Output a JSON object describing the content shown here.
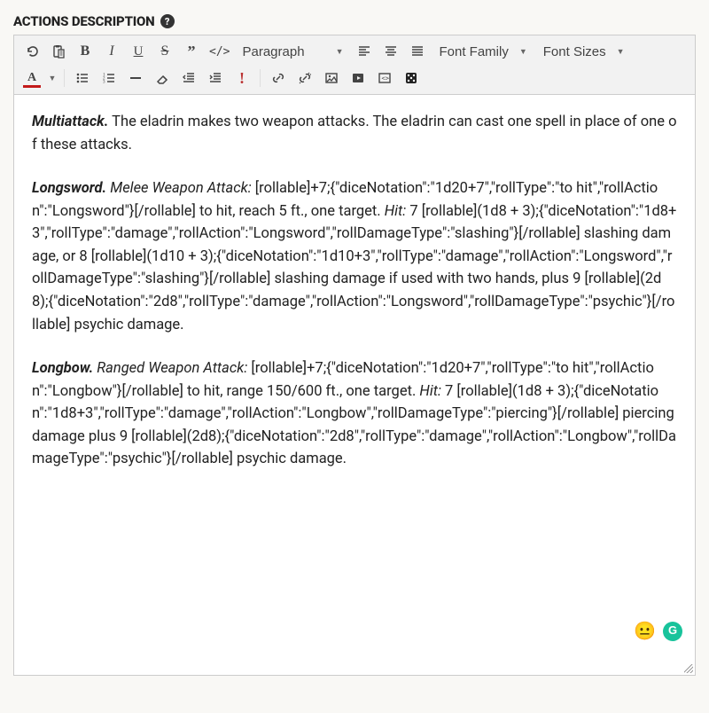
{
  "section": {
    "label": "ACTIONS DESCRIPTION"
  },
  "toolbar": {
    "paragraph_label": "Paragraph",
    "font_family_label": "Font Family",
    "font_sizes_label": "Font Sizes"
  },
  "icons": {
    "undo": "undo-icon",
    "paste": "paste-icon",
    "bold": "bold-icon",
    "italic": "italic-icon",
    "underline": "underline-icon",
    "strikethrough": "strikethrough-icon",
    "blockquote": "blockquote-icon",
    "code": "code-icon",
    "align_left": "align-left-icon",
    "align_center": "align-center-icon",
    "align_justify": "align-justify-icon",
    "text_color": "text-color-icon",
    "bullet_list": "bullet-list-icon",
    "number_list": "number-list-icon",
    "hr": "horizontal-rule-icon",
    "eraser": "eraser-icon",
    "indent": "indent-icon",
    "outdent": "outdent-icon",
    "important": "important-icon",
    "link": "link-icon",
    "magic": "magic-icon",
    "image": "image-icon",
    "video": "video-icon",
    "code_block": "code-block-icon",
    "dice": "dice-icon"
  },
  "content": {
    "multiattack_label": "Multiattack.",
    "multiattack_text": " The eladrin makes two weapon attacks. The eladrin can cast one spell in place of one of these attacks.",
    "longsword_label": "Longsword.",
    "longsword_type": " Melee Weapon Attack:",
    "longsword_body_a": " [rollable]+7;{\"diceNotation\":\"1d20+7\",\"rollType\":\"to hit\",\"rollAction\":\"Longsword\"}[/rollable] to hit, reach 5 ft., one target. ",
    "longsword_hit": "Hit:",
    "longsword_body_b": " 7 [rollable](1d8 + 3);{\"diceNotation\":\"1d8+3\",\"rollType\":\"damage\",\"rollAction\":\"Longsword\",\"rollDamageType\":\"slashing\"}[/rollable] slashing damage, or 8 [rollable](1d10 + 3);{\"diceNotation\":\"1d10+3\",\"rollType\":\"damage\",\"rollAction\":\"Longsword\",\"rollDamageType\":\"slashing\"}[/rollable] slashing damage if used with two hands, plus 9 [rollable](2d8);{\"diceNotation\":\"2d8\",\"rollType\":\"damage\",\"rollAction\":\"Longsword\",\"rollDamageType\":\"psychic\"}[/rollable] psychic damage.",
    "longbow_label": "Longbow.",
    "longbow_type": " Ranged Weapon Attack:",
    "longbow_body_a": " [rollable]+7;{\"diceNotation\":\"1d20+7\",\"rollType\":\"to hit\",\"rollAction\":\"Longbow\"}[/rollable] to hit, range 150/600 ft., one target. ",
    "longbow_hit": "Hit:",
    "longbow_body_b": " 7 [rollable](1d8 + 3);{\"diceNotation\":\"1d8+3\",\"rollType\":\"damage\",\"rollAction\":\"Longbow\",\"rollDamageType\":\"piercing\"}[/rollable] piercing damage plus 9 [rollable](2d8);{\"diceNotation\":\"2d8\",\"rollType\":\"damage\",\"rollAction\":\"Longbow\",\"rollDamageType\":\"psychic\"}[/rollable] psychic damage."
  },
  "badges": {
    "emoji": "😐",
    "grammarly": "G"
  }
}
